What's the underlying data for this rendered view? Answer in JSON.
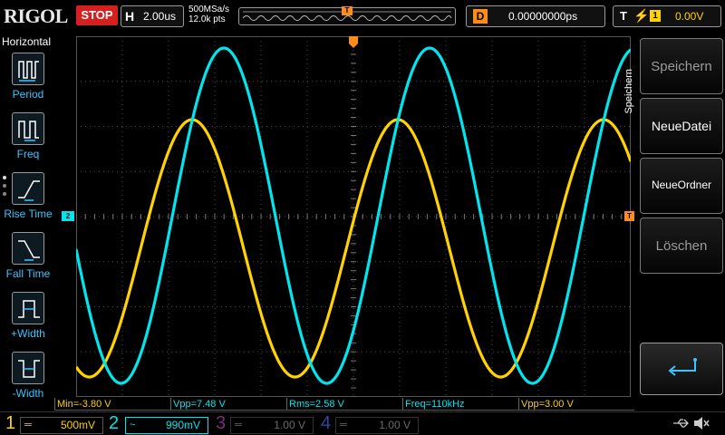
{
  "brand": "RIGOL",
  "run_state": "STOP",
  "horizontal": {
    "label": "H",
    "timebase": "2.00us",
    "sample_rate": "500MSa/s",
    "points": "12.0k pts"
  },
  "trigger_strip": {
    "marker": "T"
  },
  "delay": {
    "label": "D",
    "value": "0.00000000ps"
  },
  "trigger": {
    "label": "T",
    "edge_symbol": "⚡",
    "source": "1",
    "level": "0.00V"
  },
  "left_menu": {
    "title": "Horizontal",
    "items": [
      {
        "label": "Period",
        "icon": "period-icon"
      },
      {
        "label": "Freq",
        "icon": "frequency-icon"
      },
      {
        "label": "Rise Time",
        "icon": "rise-time-icon"
      },
      {
        "label": "Fall Time",
        "icon": "fall-time-icon"
      },
      {
        "label": "+Width",
        "icon": "positive-width-icon"
      },
      {
        "label": "-Width",
        "icon": "negative-width-icon"
      }
    ]
  },
  "markers": {
    "ch2_offset": "2",
    "trigger_level": "T",
    "trigger_position": "T"
  },
  "measurements": [
    {
      "text": "Min=-3.80 V",
      "channel": 1
    },
    {
      "text": "Vpp=7.48 V",
      "channel": 2
    },
    {
      "text": "Rms=2.58 V",
      "channel": 2
    },
    {
      "text": "Freq=110kHz",
      "channel": 2
    },
    {
      "text": "Vpp=3.00 V",
      "channel": 1
    }
  ],
  "right_menu": {
    "side_label": "Speichern",
    "buttons": [
      {
        "label": "Speichern",
        "enabled": false
      },
      {
        "label": "NeueDatei",
        "enabled": true
      },
      {
        "label": "NeueOrdner",
        "enabled": true
      },
      {
        "label": "Löschen",
        "enabled": false
      }
    ],
    "back_icon": "return-arrow-icon"
  },
  "channels": [
    {
      "num": "1",
      "coupling": "═",
      "scale": "500mV",
      "color": "#ffd200",
      "active": true
    },
    {
      "num": "2",
      "coupling": "~",
      "scale": "990mV",
      "color": "#00e5ee",
      "active": true
    },
    {
      "num": "3",
      "coupling": "═",
      "scale": "1.00 V",
      "color": "#b040b0",
      "active": false
    },
    {
      "num": "4",
      "coupling": "═",
      "scale": "1.00 V",
      "color": "#3a5fd0",
      "active": false
    }
  ],
  "status_icons": [
    "usb-icon",
    "speaker-muted-icon"
  ],
  "colors": {
    "ch1": "#ffd200",
    "ch2": "#00e5ee",
    "trigger": "#ff8c1a",
    "stop": "#d62020",
    "menu_label": "#3cc4ff"
  },
  "chart_data": {
    "type": "line",
    "x_divisions": 12,
    "y_divisions": 8,
    "timebase": "2.00us/div",
    "grid": true,
    "series": [
      {
        "name": "CH1",
        "waveform": "sine",
        "frequency_hz": 110000,
        "vpp_v": 3.0,
        "color": "#ffd200"
      },
      {
        "name": "CH2",
        "waveform": "sine",
        "frequency_hz": 110000,
        "vpp_v": 7.48,
        "color": "#00e5ee"
      }
    ]
  }
}
